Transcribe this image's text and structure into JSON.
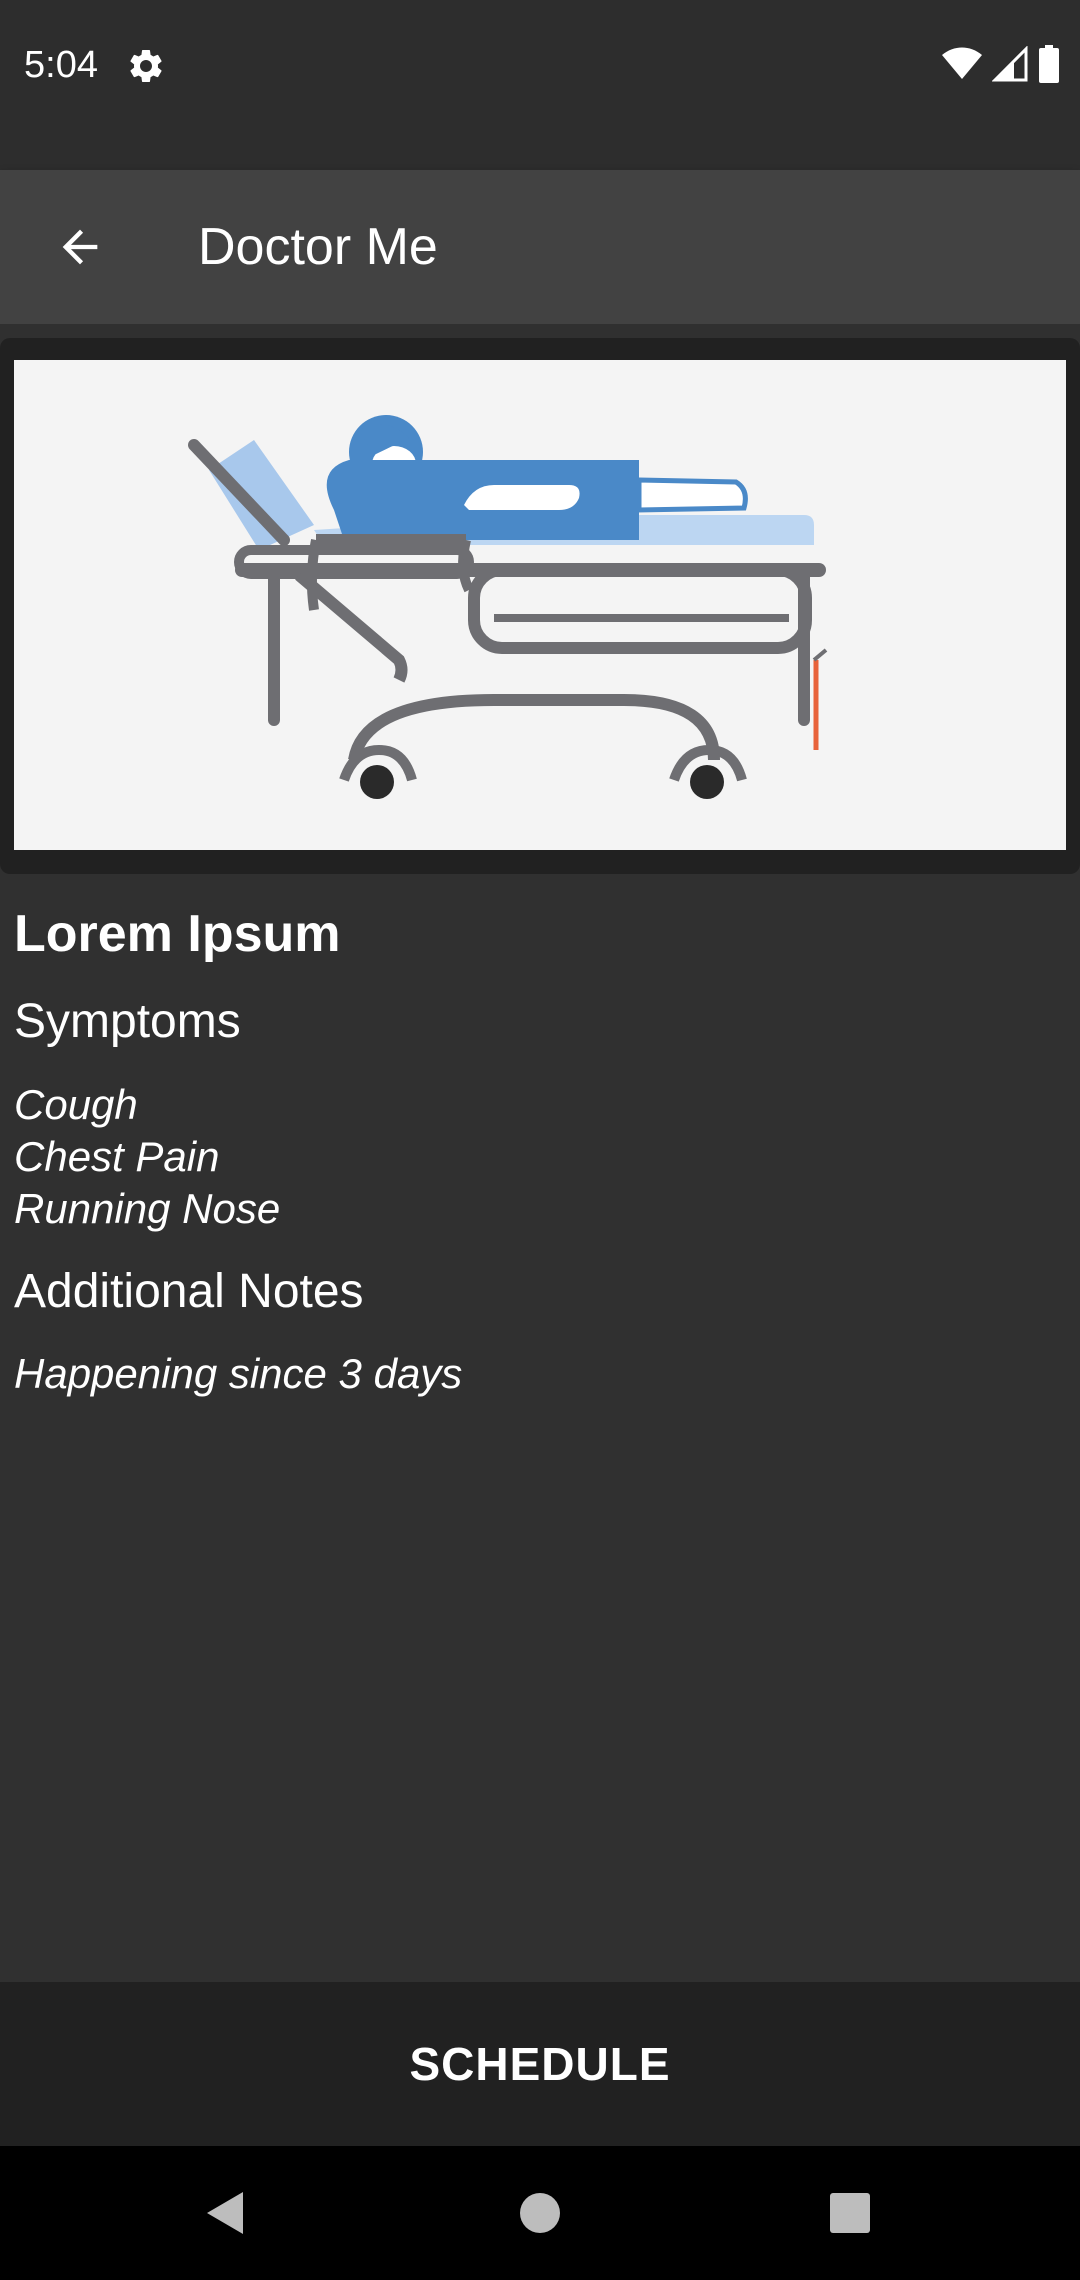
{
  "status_bar": {
    "time": "5:04",
    "icons": [
      "gear-icon",
      "wifi-icon",
      "signal-icon",
      "battery-icon"
    ]
  },
  "app_bar": {
    "title": "Doctor Me",
    "back_icon": "arrow-back-icon"
  },
  "patient": {
    "name": "Lorem Ipsum",
    "illustration": "patient-on-hospital-bed"
  },
  "symptoms": {
    "heading": "Symptoms",
    "items": [
      "Cough",
      "Chest Pain",
      "Running Nose"
    ]
  },
  "notes": {
    "heading": "Additional Notes",
    "text": "Happening since 3 days"
  },
  "actions": {
    "schedule_label": "SCHEDULE"
  },
  "nav_bar": {
    "icons": [
      "back-triangle-icon",
      "home-circle-icon",
      "recents-square-icon"
    ]
  },
  "colors": {
    "background": "#303030",
    "app_bar": "#424242",
    "status_bar": "#2d2d2d",
    "button_bar": "#212121",
    "illustration_blue": "#4a89c8",
    "illustration_gray": "#6e6e72",
    "illustration_accent": "#e8623a"
  }
}
